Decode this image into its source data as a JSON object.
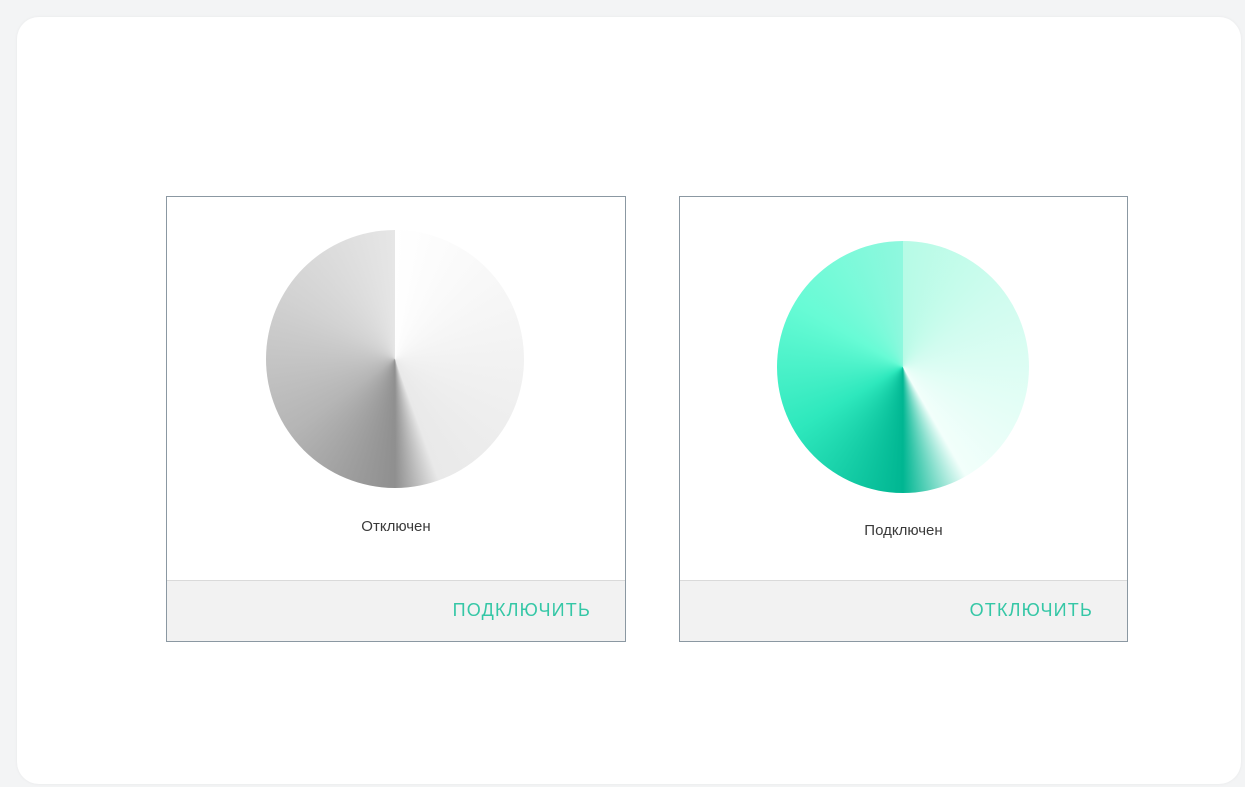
{
  "cards": [
    {
      "status": "Отключен",
      "action": "ПОДКЛЮЧИТЬ",
      "state": "disconnected",
      "disk_colors": [
        "#ffffff",
        "#8f8f8f",
        "#e6e6e6"
      ]
    },
    {
      "status": "Подключен",
      "action": "ОТКЛЮЧИТЬ",
      "state": "connected",
      "disk_colors": [
        "#b6fbe6",
        "#00b692",
        "#67fbd5"
      ]
    }
  ],
  "colors": {
    "accent": "#35c7a6",
    "card_border": "#8b98a2",
    "footer_bg": "#f2f2f2"
  }
}
